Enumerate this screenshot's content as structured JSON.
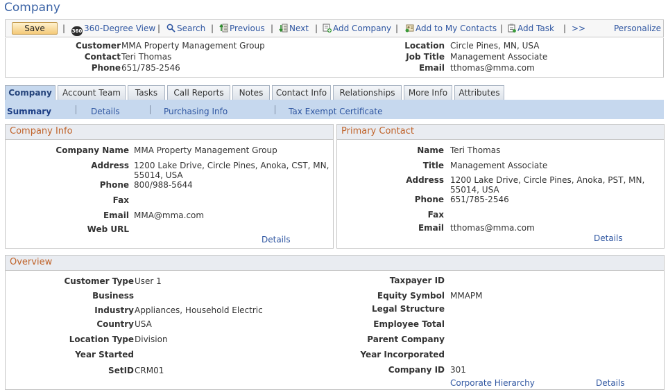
{
  "page": {
    "title": "Company"
  },
  "toolbar": {
    "save": "Save",
    "view360": "360-Degree View",
    "view360_badge": "360",
    "search": "Search",
    "previous": "Previous",
    "next": "Next",
    "add_company": "Add Company",
    "add_contacts": "Add to My Contacts",
    "add_task": "Add Task",
    "more": ">>",
    "personalize": "Personalize",
    "separator": "|"
  },
  "header": {
    "customer_label": "Customer",
    "customer": "MMA Property Management Group",
    "contact_label": "Contact",
    "contact": "Teri Thomas",
    "phone_label": "Phone",
    "phone": "651/785-2546",
    "location_label": "Location",
    "location": "Circle Pines, MN, USA",
    "jobtitle_label": "Job Title",
    "jobtitle": "Management Associate",
    "email_label": "Email",
    "email": "tthomas@mma.com"
  },
  "tabs": [
    "Company",
    "Account Team",
    "Tasks",
    "Call Reports",
    "Notes",
    "Contact Info",
    "Relationships",
    "More Info",
    "Attributes"
  ],
  "subtabs": [
    "Summary",
    "Details",
    "Purchasing Info",
    "Tax Exempt Certificate"
  ],
  "company_info": {
    "title": "Company Info",
    "name_label": "Company Name",
    "name": "MMA Property Management Group",
    "address_label": "Address",
    "address1": "1200 Lake Drive, Circle Pines, Anoka, CST, MN,",
    "address2": "55014, USA",
    "phone_label": "Phone",
    "phone": "800/988-5644",
    "fax_label": "Fax",
    "email_label": "Email",
    "email": "MMA@mma.com",
    "web_label": "Web URL",
    "details": "Details"
  },
  "primary_contact": {
    "title": "Primary Contact",
    "name_label": "Name",
    "name": "Teri Thomas",
    "title_label": "Title",
    "job_title": "Management Associate",
    "address_label": "Address",
    "address1": "1200 Lake Drive, Circle Pines, Anoka, PST, MN,",
    "address2": "55014, USA",
    "phone_label": "Phone",
    "phone": "651/785-2546",
    "fax_label": "Fax",
    "email_label": "Email",
    "email": "tthomas@mma.com",
    "details": "Details"
  },
  "overview": {
    "title": "Overview",
    "customer_type_label": "Customer Type",
    "customer_type": "User 1",
    "business_label": "Business",
    "industry_label": "Industry",
    "industry": "Appliances, Household Electric",
    "country_label": "Country",
    "country": "USA",
    "location_type_label": "Location Type",
    "location_type": "Division",
    "year_started_label": "Year Started",
    "setid_label": "SetID",
    "setid": "CRM01",
    "taxpayer_label": "Taxpayer ID",
    "equity_label": "Equity Symbol",
    "equity": "MMAPM",
    "legal_label": "Legal Structure",
    "employee_label": "Employee Total",
    "parent_label": "Parent Company",
    "year_inc_label": "Year Incorporated",
    "company_id_label": "Company ID",
    "company_id": "301",
    "hierarchy": "Corporate Hierarchy",
    "details": "Details"
  }
}
